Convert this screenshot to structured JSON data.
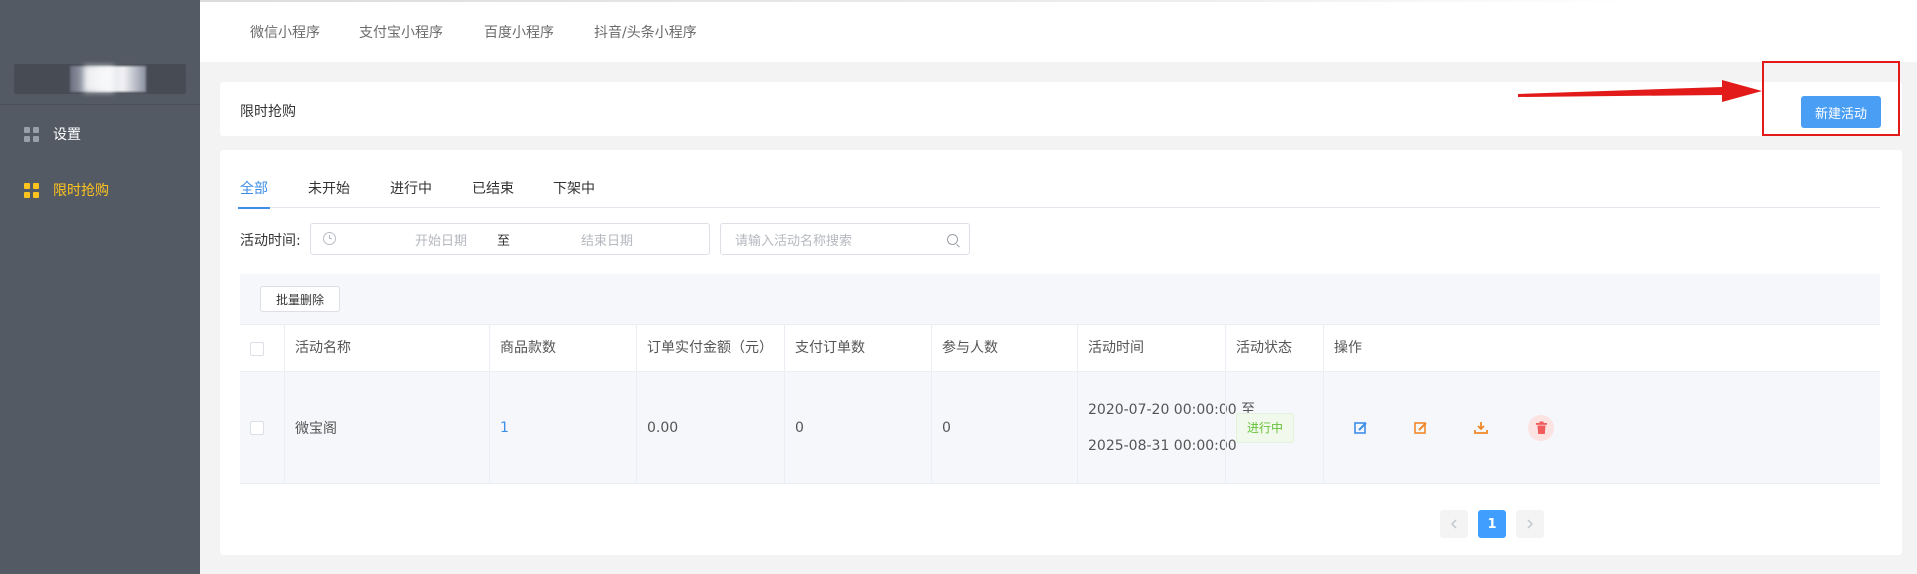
{
  "sidebar": {
    "items": [
      {
        "label": "设置",
        "icon": "grid-icon",
        "active": false
      },
      {
        "label": "限时抢购",
        "icon": "grid-icon",
        "active": true
      }
    ]
  },
  "top_tabs": [
    {
      "label": "微信小程序"
    },
    {
      "label": "支付宝小程序"
    },
    {
      "label": "百度小程序"
    },
    {
      "label": "抖音/头条小程序"
    }
  ],
  "header": {
    "title": "限时抢购",
    "new_button_label": "新建活动"
  },
  "status_tabs": [
    {
      "label": "全部",
      "active": true
    },
    {
      "label": "未开始",
      "active": false
    },
    {
      "label": "进行中",
      "active": false
    },
    {
      "label": "已结束",
      "active": false
    },
    {
      "label": "下架中",
      "active": false
    }
  ],
  "filters": {
    "time_label": "活动时间:",
    "start_placeholder": "开始日期",
    "range_separator": "至",
    "end_placeholder": "结束日期",
    "search_placeholder": "请输入活动名称搜索"
  },
  "table": {
    "batch_delete_label": "批量删除",
    "columns": [
      "活动名称",
      "商品款数",
      "订单实付金额（元）",
      "支付订单数",
      "参与人数",
      "活动时间",
      "活动状态",
      "操作"
    ],
    "rows": [
      {
        "name": "微宝阁",
        "product_count": "1",
        "paid_amount": "0.00",
        "paid_orders": "0",
        "participants": "0",
        "time_start": "2020-07-20 00:00:00 至",
        "time_end": "2025-08-31 00:00:00",
        "status": "进行中",
        "actions": [
          "edit-icon",
          "edit-icon",
          "download-icon",
          "trash-icon"
        ]
      }
    ]
  },
  "pagination": {
    "current_page": "1",
    "prev_icon": "chevron-left-icon",
    "next_icon": "chevron-right-icon"
  },
  "colors": {
    "sidebar_bg": "#545a64",
    "active_menu": "#ffc31f",
    "primary": "#409eff",
    "annotation": "#e21a1a",
    "status_green": "#67c23a"
  }
}
